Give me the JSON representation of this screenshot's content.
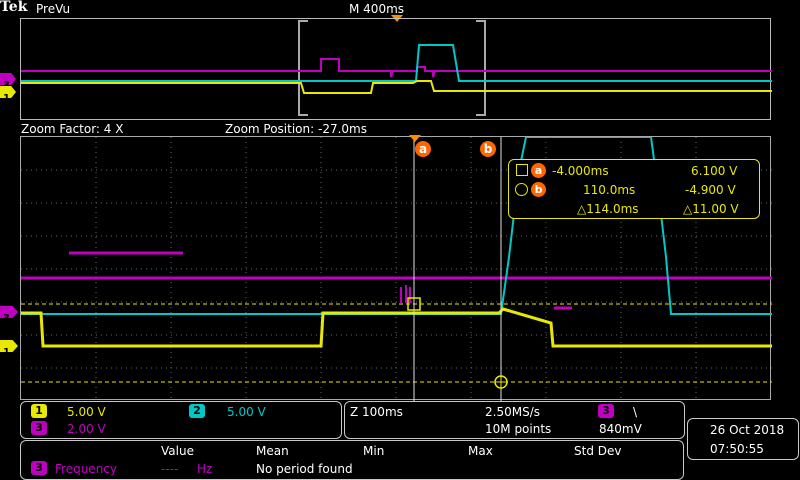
{
  "header": {
    "brand": "Tek",
    "mode": "PreVu",
    "horizontal_scale": "M 400ms"
  },
  "zoom_bar": {
    "factor": "Zoom Factor: 4 X",
    "position": "Zoom Position: -27.0ms"
  },
  "markers": {
    "ch3_ref": "3",
    "ch1_ref": "1",
    "cursor_a": "a",
    "cursor_b": "b"
  },
  "cursor_readout": {
    "a_time": "-4.000ms",
    "a_volt": "6.100 V",
    "b_time": "110.0ms",
    "b_volt": "-4.900 V",
    "delta_time": "△114.0ms",
    "delta_volt": "△11.00 V"
  },
  "channels": {
    "ch1": {
      "label": "1",
      "scale": "5.00 V",
      "color": "#e8e800"
    },
    "ch2": {
      "label": "2",
      "scale": "5.00 V",
      "color": "#00c8c8"
    },
    "ch3": {
      "label": "3",
      "scale": "2.00 V",
      "color": "#c000c0"
    }
  },
  "timebase": {
    "zoom": "Z 100ms",
    "sample_rate": "2.50MS/s",
    "record_length": "10M points",
    "trigger_source": "3",
    "trigger_slope": "\\",
    "trigger_level": "840mV"
  },
  "measurements": {
    "headers": [
      "Value",
      "Mean",
      "Min",
      "Max",
      "Std Dev"
    ],
    "row": {
      "channel": "3",
      "name": "Frequency",
      "value": "----",
      "unit": "Hz",
      "status": "No period found"
    }
  },
  "datetime": {
    "date": "26 Oct  2018",
    "time": "07:50:55"
  },
  "colors": {
    "ch1": "#e8e800",
    "ch2": "#00c8c8",
    "ch3": "#c000c0",
    "cursor": "#ff6600",
    "grid": "#6e6e6e"
  }
}
